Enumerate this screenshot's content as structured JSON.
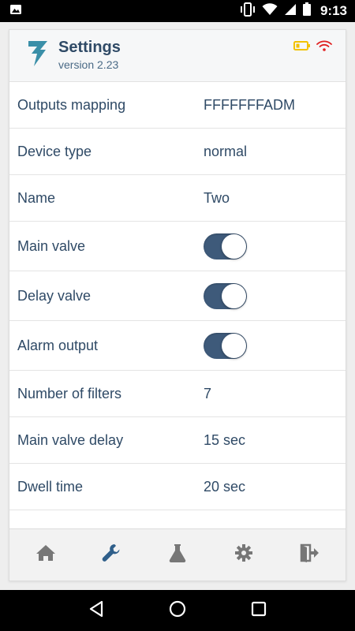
{
  "status_bar": {
    "time": "9:13",
    "icons": [
      "image-icon",
      "vibrate-icon",
      "wifi-icon",
      "signal-icon",
      "battery-icon"
    ]
  },
  "header": {
    "title": "Settings",
    "version": "version 2.23",
    "status_icons": [
      "battery-low-icon",
      "wifi-warning-icon"
    ],
    "colors": {
      "battery": "#f2c200",
      "wifi": "#e02020"
    }
  },
  "settings": {
    "rows": [
      {
        "label": "Outputs mapping",
        "value": "FFFFFFFADM"
      },
      {
        "label": "Device type",
        "value": "normal"
      },
      {
        "label": "Name",
        "value": "Two"
      },
      {
        "label": "Main valve",
        "toggle": true
      },
      {
        "label": "Delay valve",
        "toggle": true
      },
      {
        "label": "Alarm output",
        "toggle": true
      },
      {
        "label": "Number of filters",
        "value": "7"
      },
      {
        "label": "Main valve delay",
        "value": "15 sec"
      },
      {
        "label": "Dwell time",
        "value": "20 sec"
      }
    ]
  },
  "bottom_nav": {
    "items": [
      "home-icon",
      "wrench-icon",
      "flask-icon",
      "gear-icon",
      "exit-icon"
    ],
    "active": "wrench-icon",
    "colors": {
      "active": "#2f5f8a",
      "inactive": "#777777"
    }
  },
  "android_nav": [
    "back-icon",
    "home-circle-icon",
    "recents-icon"
  ],
  "colors": {
    "text": "#2f4a66",
    "toggle_on": "#3e5a7a",
    "logo": "#3a8fa8"
  }
}
